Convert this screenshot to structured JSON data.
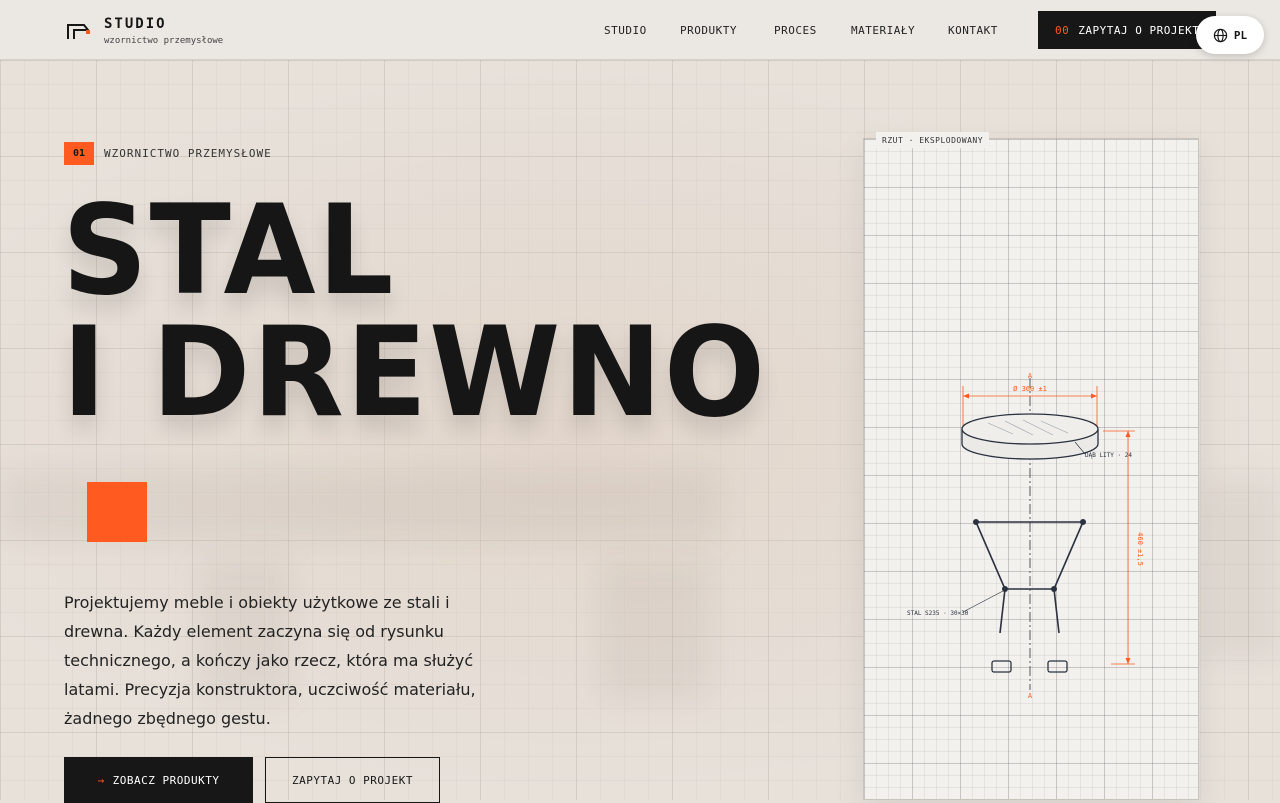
{
  "header": {
    "logo_title": "STUDIO",
    "logo_subtitle": "wzornictwo przemysłowe",
    "nav": [
      {
        "label": "STUDIO"
      },
      {
        "label": "PRODUKTY"
      },
      {
        "label": "PROCES"
      },
      {
        "label": "MATERIAŁY"
      },
      {
        "label": "KONTAKT"
      }
    ],
    "cta_number": "00",
    "cta_label": "ZAPYTAJ O PROJEKT",
    "language": "PL"
  },
  "hero": {
    "kicker_number": "01",
    "kicker_text": "WZORNICTWO PRZEMYSŁOWE",
    "headline_line1": "STAL",
    "headline_line2": "I DREWNO",
    "lead": "Projektujemy meble i obiekty użytkowe ze stali i drewna. Każdy element zaczyna się od rysunku technicznego, a kończy jako rzecz, która ma służyć latami. Precyzja konstruktora, uczciwość materiału, żadnego zbędnego gestu.",
    "primary_button": "ZOBACZ PRODUKTY",
    "secondary_button": "ZAPYTAJ O PROJEKT"
  },
  "drawing": {
    "label": "RZUT · EKSPLODOWANY",
    "section_mark": "A",
    "diameter_dim": "Ø 360 ±1",
    "top_material": "DĄB LITY · 24",
    "height_dim": "460 ±1,5",
    "frame_material": "STAL S235 · 30×30"
  },
  "colors": {
    "accent": "#ff5a1f",
    "ink": "#161616",
    "background": "#e7e1da",
    "drawing_line": "#2a3140"
  }
}
